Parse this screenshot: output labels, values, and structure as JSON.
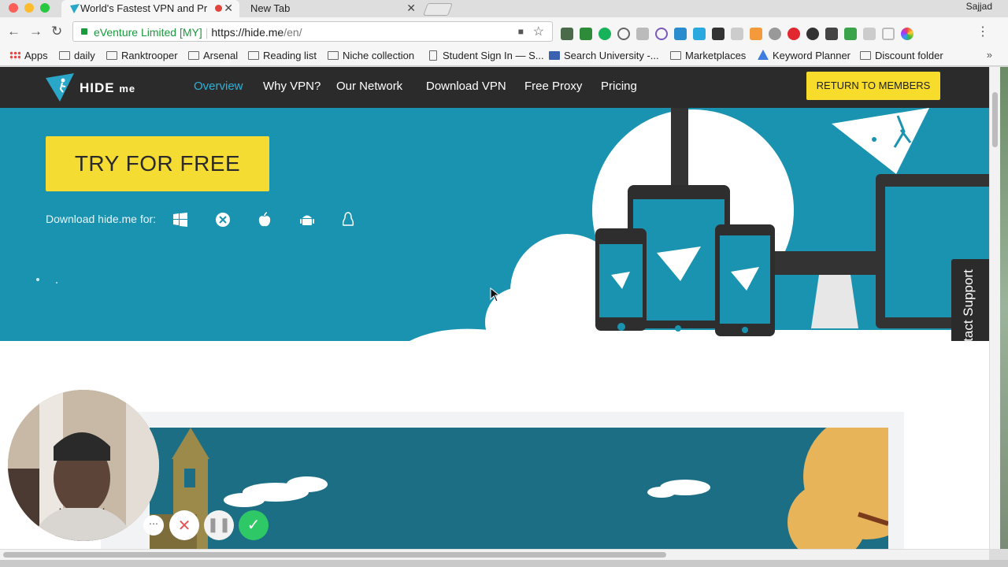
{
  "window": {
    "tabs": [
      {
        "title": "World's Fastest VPN and Pr",
        "active": true
      },
      {
        "title": "New Tab",
        "active": false
      }
    ],
    "profile_name": "Sajjad"
  },
  "toolbar": {
    "org_name": "eVenture Limited [MY]",
    "url_host": "https://hide.me",
    "url_path": "/en/"
  },
  "bookmarks": [
    {
      "label": "Apps",
      "icon": "apps-grid-icon"
    },
    {
      "label": "daily",
      "icon": "folder-icon"
    },
    {
      "label": "Ranktrooper",
      "icon": "folder-icon"
    },
    {
      "label": "Arsenal",
      "icon": "folder-icon"
    },
    {
      "label": "Reading list",
      "icon": "folder-icon"
    },
    {
      "label": "Niche collection",
      "icon": "folder-icon"
    },
    {
      "label": "Student Sign In — S...",
      "icon": "page-icon"
    },
    {
      "label": "Search University -...",
      "icon": "university-icon"
    },
    {
      "label": "Marketplaces",
      "icon": "folder-icon"
    },
    {
      "label": "Keyword Planner",
      "icon": "google-ads-icon"
    },
    {
      "label": "Discount folder",
      "icon": "folder-icon"
    }
  ],
  "site": {
    "logo": {
      "text": "HIDE",
      "suffix": "me"
    },
    "nav": [
      {
        "label": "Overview",
        "active": true
      },
      {
        "label": "Why VPN?",
        "active": false
      },
      {
        "label": "Our Network",
        "active": false
      },
      {
        "label": "Download VPN",
        "active": false
      },
      {
        "label": "Free Proxy",
        "active": false
      },
      {
        "label": "Pricing",
        "active": false
      }
    ],
    "members_button": "RETURN TO MEMBERS",
    "hero": {
      "cta": "TRY FOR FREE",
      "download_label": "Download hide.me for:",
      "platforms": [
        "windows-icon",
        "macos-x-icon",
        "apple-icon",
        "android-icon",
        "linux-icon"
      ]
    },
    "support_tab": "Contact Support"
  },
  "colors": {
    "brand_blue": "#1a93b0",
    "nav_dark": "#2b2b2b",
    "cta_yellow": "#f5dc32",
    "active_link": "#2fb0d6"
  },
  "recorder_controls": [
    "more-icon",
    "cancel-icon",
    "pause-icon",
    "confirm-check-icon"
  ]
}
